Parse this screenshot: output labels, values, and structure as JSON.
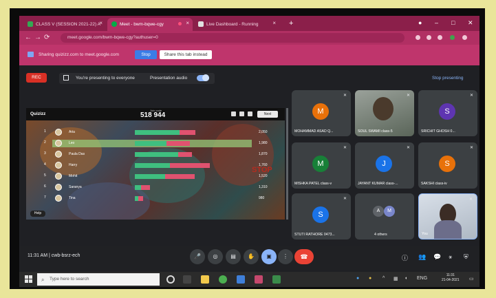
{
  "browser": {
    "tabs": [
      {
        "label": "CLASS V (SESSION 2021-22) A"
      },
      {
        "label": "Meet - bwm-bqwe-cgy"
      },
      {
        "label": "Live Dashboard - Running"
      }
    ],
    "new_tab": "+",
    "window_controls": {
      "minimize": "–",
      "maximize": "□",
      "close": "✕"
    },
    "back": "←",
    "forward": "→",
    "reload": "⟳",
    "url": "meet.google.com/bwm-bqwe-cgy?authuser=0"
  },
  "share_bar": {
    "message": "Sharing quizizz.com to meet.google.com",
    "stop_label": "Stop",
    "hide_label": "Share this tab instead"
  },
  "meet": {
    "rec_label": "REC",
    "presenting_text": "You're presenting to everyone",
    "audio_text": "Presentation audio",
    "stop_presenting": "Stop presenting",
    "time_code": "11:31 AM  |  cwb-bsrz-ech",
    "colors": {
      "accent": "#8ab4f8",
      "end_call": "#ea4335",
      "rec": "#d93025"
    }
  },
  "quiz": {
    "logo": "Quizizz",
    "score": "518 944",
    "score_caption": "Join code",
    "next_label": "Next",
    "help_label": "Help",
    "stop_sign": "STOP",
    "rows": [
      {
        "rank": "1",
        "name": "Aria",
        "score": "2,050",
        "highlight": false,
        "green": 0.38,
        "red": 0.14
      },
      {
        "rank": "2",
        "name": "Leo",
        "score": "1,980",
        "highlight": true,
        "green": 0.27,
        "red": 0.2
      },
      {
        "rank": "3",
        "name": "Paula Das",
        "score": "1,870",
        "highlight": false,
        "green": 0.37,
        "red": 0.12
      },
      {
        "rank": "4",
        "name": "Harry",
        "score": "1,760",
        "highlight": false,
        "green": 0.3,
        "red": 0.34
      },
      {
        "rank": "5",
        "name": "Mohit",
        "score": "1,520",
        "highlight": false,
        "green": 0.26,
        "red": 0.25
      },
      {
        "rank": "6",
        "name": "Saranya",
        "score": "1,310",
        "highlight": false,
        "green": 0.05,
        "red": 0.08
      },
      {
        "rank": "7",
        "name": "Tina",
        "score": "980",
        "highlight": false,
        "green": 0.03,
        "red": 0.04
      }
    ]
  },
  "participants": [
    {
      "name": "MOHAMMAD ASAD Q...",
      "initial": "M",
      "color": "#e8710a",
      "type": "avatar"
    },
    {
      "name": "SOUL SWAMI class-5",
      "initial": "",
      "color": "",
      "type": "video"
    },
    {
      "name": "SRICHIT GHOSH 0...",
      "initial": "S",
      "color": "#5e35b1",
      "type": "avatar"
    },
    {
      "name": "MISHKA PATEL class-v",
      "initial": "M",
      "color": "#188038",
      "type": "avatar"
    },
    {
      "name": "JAYANT KUMAR class-...",
      "initial": "J",
      "color": "#1a73e8",
      "type": "avatar"
    },
    {
      "name": "SAKSHI class-iv",
      "initial": "S",
      "color": "#e8710a",
      "type": "avatar"
    },
    {
      "name": "STUTI RATHORE 0473...",
      "initial": "S",
      "color": "#1a73e8",
      "type": "avatar"
    },
    {
      "name": "4 others",
      "initial": "",
      "color": "",
      "type": "others"
    },
    {
      "name": "You",
      "initial": "",
      "color": "",
      "type": "self"
    }
  ],
  "others_avatars": [
    {
      "initial": "A",
      "color": "#5f6368"
    },
    {
      "initial": "M",
      "color": "#7986cb"
    }
  ],
  "controls": {
    "mic": "🎤",
    "camera": "◎",
    "captions": "▤",
    "raise_hand": "✋",
    "present": "▣",
    "more": "⋮",
    "end": "☎",
    "info": "ⓘ",
    "people": "👥",
    "chat": "💬",
    "activities": "⚹",
    "host": "⛨"
  },
  "taskbar": {
    "search_placeholder": "Type here to search",
    "clock_time": "11:31",
    "clock_date": "21-04-2021",
    "lang": "ENG"
  }
}
